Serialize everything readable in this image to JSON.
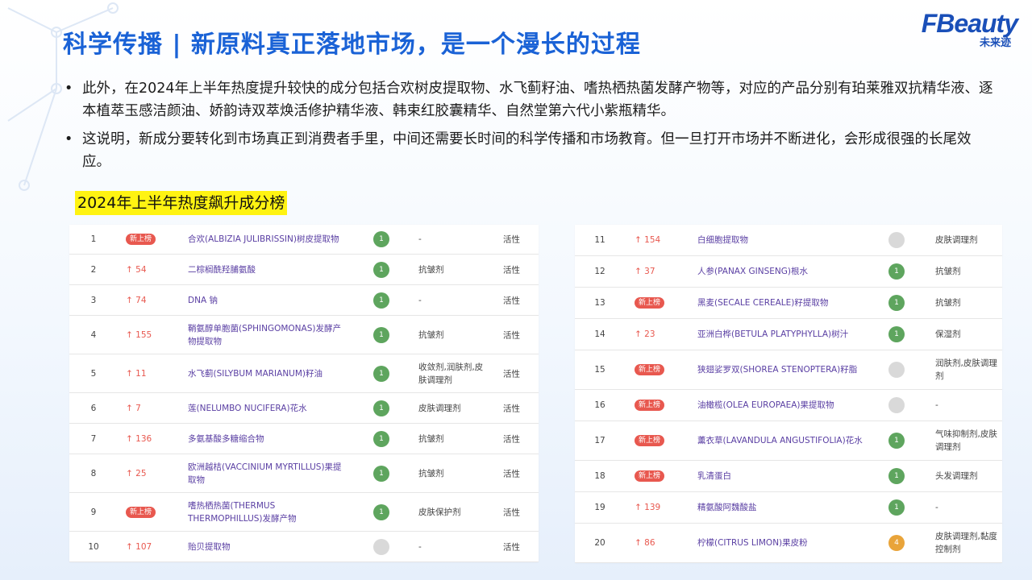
{
  "page": {
    "title": "科学传播 | 新原料真正落地市场，是一个漫长的过程",
    "logo_main": "FBeauty",
    "logo_sub": "未来迹"
  },
  "bullets": [
    "此外，在2024年上半年热度提升较快的成分包括合欢树皮提取物、水飞蓟籽油、嗜热栖热菌发酵产物等，对应的产品分别有珀莱雅双抗精华液、逐本植萃玉感洁颜油、娇韵诗双萃焕活修护精华液、韩束红胶囊精华、自然堂第六代小紫瓶精华。",
    "这说明，新成分要转化到市场真正到消费者手里，中间还需要长时间的科学传播和市场教育。但一旦打开市场并不断进化，会形成很强的长尾效应。"
  ],
  "ranking": {
    "title": "2024年上半年热度飙升成分榜",
    "colors": {
      "new_badge": "#e8584f",
      "score_green": "#5ea55e",
      "score_gray": "#d9d9d9",
      "score_orange": "#e9a43a"
    },
    "left": [
      {
        "rank": "1",
        "trend": "新上榜",
        "is_new": true,
        "name": "合欢(ALBIZIA JULIBRISSIN)树皮提取物",
        "score": "1",
        "score_color": "green",
        "func": "-",
        "type": "活性"
      },
      {
        "rank": "2",
        "trend": "↑ 54",
        "is_new": false,
        "name": "二棕榈酰羟脯氨酸",
        "score": "1",
        "score_color": "green",
        "func": "抗皱剂",
        "type": "活性"
      },
      {
        "rank": "3",
        "trend": "↑ 74",
        "is_new": false,
        "name": "DNA 钠",
        "score": "1",
        "score_color": "green",
        "func": "-",
        "type": "活性"
      },
      {
        "rank": "4",
        "trend": "↑ 155",
        "is_new": false,
        "name": "鞘氨醇单胞菌(SPHINGOMONAS)发酵产物提取物",
        "score": "1",
        "score_color": "green",
        "func": "抗皱剂",
        "type": "活性"
      },
      {
        "rank": "5",
        "trend": "↑ 11",
        "is_new": false,
        "name": "水飞蓟(SILYBUM MARIANUM)籽油",
        "score": "1",
        "score_color": "green",
        "func": "收敛剂,润肤剂,皮肤调理剂",
        "type": "活性"
      },
      {
        "rank": "6",
        "trend": "↑ 7",
        "is_new": false,
        "name": "莲(NELUMBO NUCIFERA)花水",
        "score": "1",
        "score_color": "green",
        "func": "皮肤调理剂",
        "type": "活性"
      },
      {
        "rank": "7",
        "trend": "↑ 136",
        "is_new": false,
        "name": "多氨基酸多糖缩合物",
        "score": "1",
        "score_color": "green",
        "func": "抗皱剂",
        "type": "活性"
      },
      {
        "rank": "8",
        "trend": "↑ 25",
        "is_new": false,
        "name": "欧洲越桔(VACCINIUM MYRTILLUS)果提取物",
        "score": "1",
        "score_color": "green",
        "func": "抗皱剂",
        "type": "活性"
      },
      {
        "rank": "9",
        "trend": "新上榜",
        "is_new": true,
        "name": "嗜热栖热菌(THERMUS THERMOPHILLUS)发酵产物",
        "score": "1",
        "score_color": "green",
        "func": "皮肤保护剂",
        "type": "活性"
      },
      {
        "rank": "10",
        "trend": "↑ 107",
        "is_new": false,
        "name": "贻贝提取物",
        "score": "-",
        "score_color": "gray",
        "func": "-",
        "type": "活性"
      }
    ],
    "right": [
      {
        "rank": "11",
        "trend": "↑ 154",
        "is_new": false,
        "name": "白细胞提取物",
        "score": "-",
        "score_color": "gray",
        "func": "皮肤调理剂"
      },
      {
        "rank": "12",
        "trend": "↑ 37",
        "is_new": false,
        "name": "人参(PANAX GINSENG)根水",
        "score": "1",
        "score_color": "green",
        "func": "抗皱剂"
      },
      {
        "rank": "13",
        "trend": "新上榜",
        "is_new": true,
        "name": "黑麦(SECALE CEREALE)籽提取物",
        "score": "1",
        "score_color": "green",
        "func": "抗皱剂"
      },
      {
        "rank": "14",
        "trend": "↑ 23",
        "is_new": false,
        "name": "亚洲白桦(BETULA PLATYPHYLLA)树汁",
        "score": "1",
        "score_color": "green",
        "func": "保湿剂"
      },
      {
        "rank": "15",
        "trend": "新上榜",
        "is_new": true,
        "name": "狭翅娑罗双(SHOREA STENOPTERA)籽脂",
        "score": "-",
        "score_color": "gray",
        "func": "润肤剂,皮肤调理剂"
      },
      {
        "rank": "16",
        "trend": "新上榜",
        "is_new": true,
        "name": "油橄榄(OLEA EUROPAEA)果提取物",
        "score": "-",
        "score_color": "gray",
        "func": "-"
      },
      {
        "rank": "17",
        "trend": "新上榜",
        "is_new": true,
        "name": "薰衣草(LAVANDULA ANGUSTIFOLIA)花水",
        "score": "1",
        "score_color": "green",
        "func": "气味抑制剂,皮肤调理剂"
      },
      {
        "rank": "18",
        "trend": "新上榜",
        "is_new": true,
        "name": "乳清蛋白",
        "score": "1",
        "score_color": "green",
        "func": "头发调理剂"
      },
      {
        "rank": "19",
        "trend": "↑ 139",
        "is_new": false,
        "name": "精氨酸阿魏酸盐",
        "score": "1",
        "score_color": "green",
        "func": "-"
      },
      {
        "rank": "20",
        "trend": "↑ 86",
        "is_new": false,
        "name": "柠檬(CITRUS LIMON)果皮粉",
        "score": "4",
        "score_color": "orange",
        "func": "皮肤调理剂,黏度控制剂"
      }
    ]
  }
}
